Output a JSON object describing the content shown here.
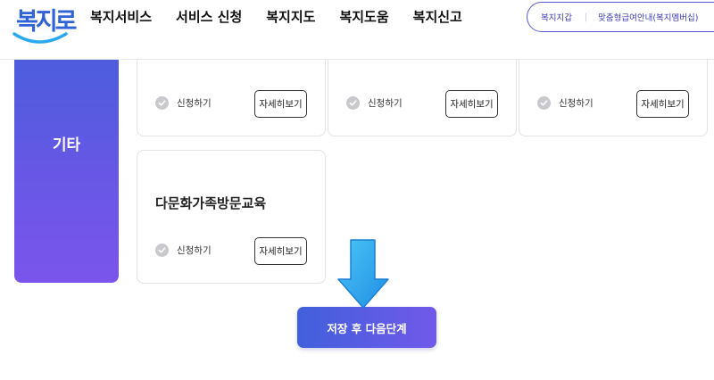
{
  "header": {
    "logo": "복지로",
    "nav": [
      "복지서비스",
      "서비스 신청",
      "복지지도",
      "복지도움",
      "복지신고"
    ],
    "util_links": [
      "복지지갑",
      "맞춤형급여안내(복지멤버십)"
    ]
  },
  "category": {
    "title": "기타"
  },
  "cards": [
    {
      "title": "",
      "apply_label": "신청하기",
      "detail_label": "자세히보기"
    },
    {
      "title": "",
      "apply_label": "신청하기",
      "detail_label": "자세히보기"
    },
    {
      "title": "",
      "apply_label": "신청하기",
      "detail_label": "자세히보기"
    },
    {
      "title": "다문화가족방문교육",
      "apply_label": "신청하기",
      "detail_label": "자세히보기"
    }
  ],
  "next_button": {
    "label": "저장 후 다음단계"
  },
  "colors": {
    "brand_blue": "#2f63d6",
    "gradient_start": "#4160dc",
    "gradient_end": "#7159ea",
    "arrow": "#2aa8ef"
  },
  "icons": [
    "check-circle-icon",
    "down-arrow-icon"
  ]
}
